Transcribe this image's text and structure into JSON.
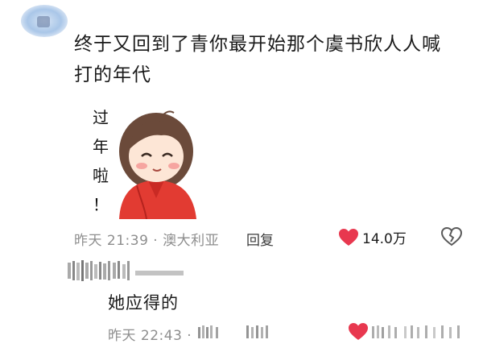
{
  "comment": {
    "text": "终于又回到了青你最开始那个虞书欣人人喊打的年代",
    "sticker_text": [
      "过",
      "年",
      "啦",
      "！"
    ],
    "time": "昨天 21:39 · 澳大利亚",
    "reply_label": "回复",
    "likes": "14.0万",
    "colors": {
      "like": "#e8384f",
      "meta": "#8e8e8e"
    }
  },
  "reply": {
    "text": "她应得的",
    "time": "昨天 22:43 ·",
    "likes_obscured": true
  },
  "icons": [
    "avatar",
    "heart-icon",
    "broken-heart-icon"
  ]
}
